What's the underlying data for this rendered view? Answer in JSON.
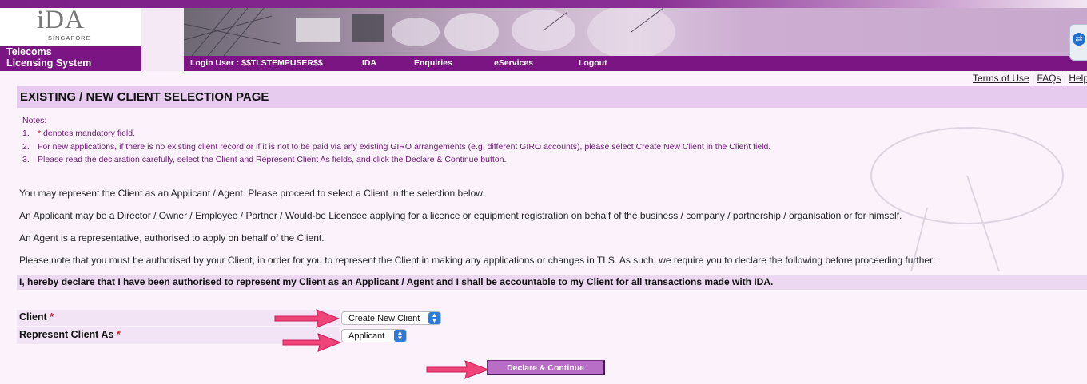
{
  "header": {
    "logo_main": "iDA",
    "logo_sub": "SINGAPORE",
    "app_name_line1": "Telecoms",
    "app_name_line2": "Licensing System",
    "login_label": "Login User : $$TLSTEMPUSER$$",
    "nav": [
      "IDA",
      "Enquiries",
      "eServices",
      "Logout"
    ]
  },
  "top_links": {
    "terms": "Terms of Use",
    "faqs": "FAQs",
    "help": "Help",
    "sep": "|"
  },
  "page": {
    "title": "EXISTING / NEW CLIENT SELECTION PAGE",
    "notes_heading": "Notes:",
    "notes": [
      {
        "num": "1.",
        "star": "*",
        "text": " denotes mandatory field."
      },
      {
        "num": "2.",
        "star": "",
        "text": "For new applications, if there is no existing client record or if it is not to be paid via any existing GIRO arrangements (e.g. different GIRO accounts), please select Create New Client in the Client field."
      },
      {
        "num": "3.",
        "star": "",
        "text": "Please read the declaration carefully, select the Client and Represent Client As fields, and click the Declare & Continue button."
      }
    ],
    "paragraphs": [
      "You may represent the Client as an Applicant / Agent. Please proceed to select a Client in the selection below.",
      "An Applicant may be a Director / Owner / Employee / Partner / Would-be Licensee applying for a licence or equipment registration on behalf of the business / company / partnership / organisation or for himself.",
      "An Agent is a representative, authorised to apply on behalf of the Client.",
      "Please note that you must be authorised by your Client, in order for you to represent the Client in making any applications or changes in TLS. As such, we require you to declare the following before proceeding further:"
    ],
    "declaration": "I, hereby declare that I have been authorised to represent my Client as an Applicant / Agent and I shall be accountable to my Client for all transactions made with IDA."
  },
  "form": {
    "client_label": "Client",
    "client_value": "Create New Client",
    "represent_label": "Represent Client As",
    "represent_value": "Applicant",
    "required_mark": "*",
    "submit_label": "Declare & Continue"
  },
  "colors": {
    "brand_purple": "#7b1583",
    "title_bar": "#e7cbee",
    "button": "#b86ec6",
    "required": "#d4141b",
    "annotation_arrow": "#f0437a"
  }
}
